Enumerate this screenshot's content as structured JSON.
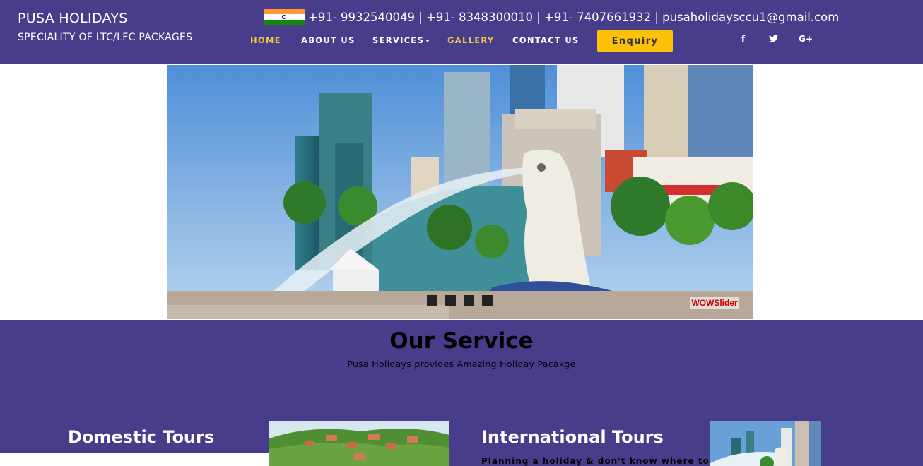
{
  "brand": {
    "title": "PUSA HOLIDAYS",
    "subtitle": "SPECIALITY OF LTC/LFC PACKAGES"
  },
  "contact": {
    "line": "+91- 9932540049 | +91- 8348300010 | +91- 7407661932 | pusaholidaysccu1@gmail.com",
    "flag_icon": "india-flag-icon"
  },
  "nav": {
    "home": "HOME",
    "about": "ABOUT US",
    "services": "SERVICES",
    "gallery": "GALLERY",
    "contact": "CONTACT US",
    "enquiry": "Enquiry"
  },
  "social": {
    "facebook": "f",
    "twitter": "t",
    "google": "G+"
  },
  "slider": {
    "watermark": "WOWSlider",
    "dots_count": 4
  },
  "service": {
    "title": "Our Service",
    "subtitle": "Pusa Holidays provides Amazing Holiday Pacakge",
    "domestic_heading": "Domestic Tours",
    "international_heading": "International Tours",
    "international_text": "Planning a holiday & don't know where to"
  },
  "colors": {
    "primary": "#483d8b",
    "accent": "#ffc107",
    "active_nav": "#f0c14b"
  }
}
